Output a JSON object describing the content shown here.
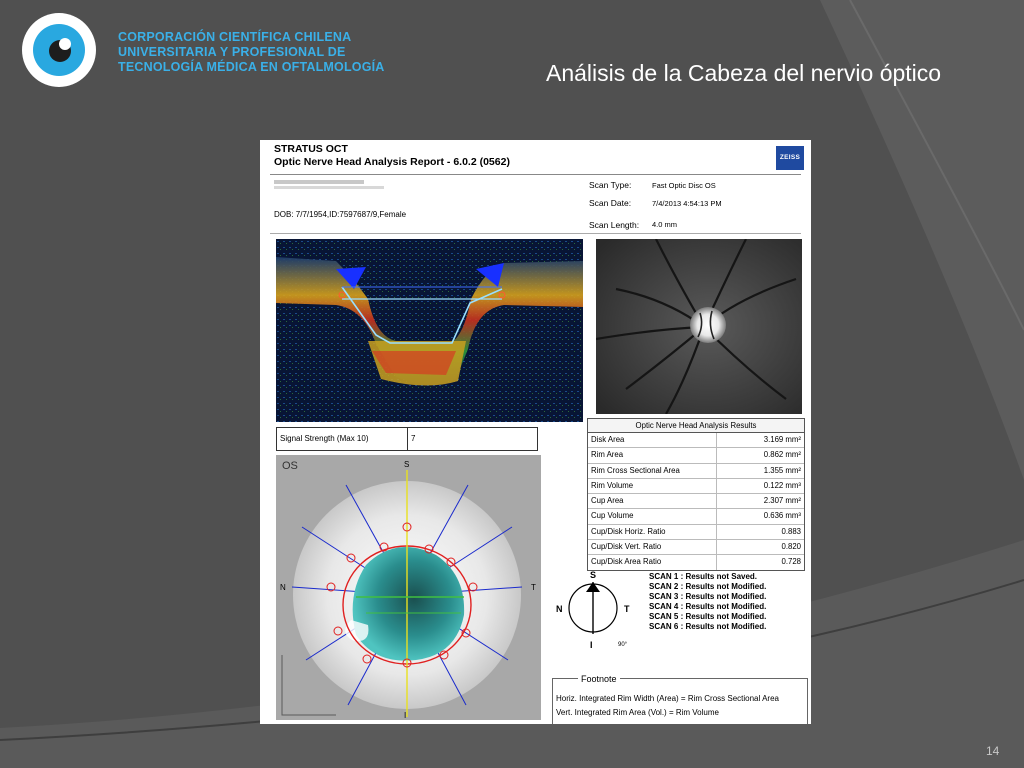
{
  "organization": {
    "line1": "CORPORACIÓN CIENTÍFICA CHILENA",
    "line2": "UNIVERSITARIA Y PROFESIONAL DE",
    "line3": "TECNOLOGÍA MÉDICA EN OFTALMOLOGÍA"
  },
  "slide": {
    "title": "Análisis de la Cabeza del nervio óptico",
    "page_number": "14"
  },
  "colors": {
    "background": "#505050",
    "accent": "#29a8e0",
    "org_text": "#3ab0e8"
  },
  "report": {
    "title1": "STRATUS OCT",
    "title2": "Optic Nerve Head Analysis Report - 6.0.2 (0562)",
    "brand": "ZEISS",
    "dob": "DOB: 7/7/1954,ID:7597687/9,Female",
    "scan_type_label": "Scan Type:",
    "scan_type_value": "Fast Optic Disc  OS",
    "scan_date_label": "Scan Date:",
    "scan_date_value": "7/4/2013 4:54:13 PM",
    "scan_length_label": "Scan Length:",
    "scan_length_value": "4.0 mm",
    "signal_label": "Signal Strength (Max 10)",
    "signal_value": "7",
    "eye_label": "OS",
    "map_s": "S",
    "map_i": "I",
    "map_n": "N",
    "map_t": "T",
    "compass_s": "S",
    "compass_i": "I",
    "compass_n": "N",
    "compass_t": "T",
    "compass_angle": "90°",
    "results_title": "Optic Nerve Head Analysis Results",
    "results": [
      {
        "label": "Disk Area",
        "value": "3.169 mm²"
      },
      {
        "label": "Rim Area",
        "value": "0.862 mm²"
      },
      {
        "label": "Rim Cross Sectional Area",
        "value": "1.355 mm²"
      },
      {
        "label": "Rim Volume",
        "value": "0.122 mm³"
      },
      {
        "label": "Cup Area",
        "value": "2.307 mm²"
      },
      {
        "label": "Cup Volume",
        "value": "0.636 mm³"
      },
      {
        "label": "Cup/Disk Horiz. Ratio",
        "value": "0.883"
      },
      {
        "label": "Cup/Disk Vert. Ratio",
        "value": "0.820"
      },
      {
        "label": "Cup/Disk Area Ratio",
        "value": "0.728"
      }
    ],
    "scans": [
      "SCAN 1 : Results not Saved.",
      "SCAN 2 : Results not Modified.",
      "SCAN 3 : Results not Modified.",
      "SCAN 4 : Results not Modified.",
      "SCAN 5 : Results not Modified.",
      "SCAN 6 : Results not Modified."
    ],
    "footnote_title": "Footnote",
    "footnote_1": "Horiz. Integrated Rim Width (Area) = Rim Cross Sectional Area",
    "footnote_2": "Vert. Integrated Rim Area (Vol.) = Rim Volume"
  }
}
